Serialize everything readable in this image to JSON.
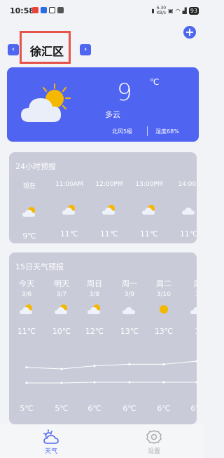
{
  "status_bar": {
    "time": "10:58",
    "net_speed_value": "6.30",
    "net_speed_unit": "KB/s",
    "battery": "93"
  },
  "header": {
    "city": "徐汇区",
    "prev_arrow": "‹",
    "next_arrow": "›",
    "add_symbol": "+"
  },
  "current": {
    "temperature": "9",
    "unit": "℃",
    "condition": "多云",
    "wind": "北风5级",
    "humidity": "湿度68%",
    "icon": "partly-cloudy-icon"
  },
  "hourly": {
    "title": "24小时预报",
    "items": [
      {
        "time": "现在",
        "temp": "9℃",
        "icon": "partly-cloudy-icon"
      },
      {
        "time": "11:00AM",
        "temp": "11℃",
        "icon": "partly-cloudy-icon"
      },
      {
        "time": "12:00PM",
        "temp": "11℃",
        "icon": "partly-cloudy-icon"
      },
      {
        "time": "13:00PM",
        "temp": "11℃",
        "icon": "partly-cloudy-icon"
      },
      {
        "time": "14:00P",
        "temp": "11℃",
        "icon": "cloudy-icon"
      }
    ]
  },
  "daily": {
    "title": "15日天气预报",
    "items": [
      {
        "day": "今天",
        "date": "3/6",
        "high": "11℃",
        "low": "5℃",
        "icon": "partly-cloudy-icon"
      },
      {
        "day": "明天",
        "date": "3/7",
        "high": "10℃",
        "low": "5℃",
        "icon": "partly-cloudy-icon"
      },
      {
        "day": "周日",
        "date": "3/8",
        "high": "12℃",
        "low": "6℃",
        "icon": "partly-cloudy-icon"
      },
      {
        "day": "周一",
        "date": "3/9",
        "high": "13℃",
        "low": "6℃",
        "icon": "cloudy-icon"
      },
      {
        "day": "周二",
        "date": "3/10",
        "high": "13℃",
        "low": "6℃",
        "icon": "sunny-icon"
      },
      {
        "day": "周",
        "date": "3",
        "high": "1",
        "low": "6℃",
        "icon": "cloudy-icon"
      }
    ],
    "high_values": [
      11,
      10,
      12,
      13,
      13,
      15
    ],
    "low_values": [
      5,
      5,
      6,
      6,
      6,
      6
    ]
  },
  "tabbar": {
    "weather_label": "天气",
    "settings_label": "设置"
  },
  "colors": {
    "accent": "#4f66f1",
    "card": "#c9cbd8",
    "highlight_box": "#e5534b",
    "sun": "#f5b800"
  }
}
